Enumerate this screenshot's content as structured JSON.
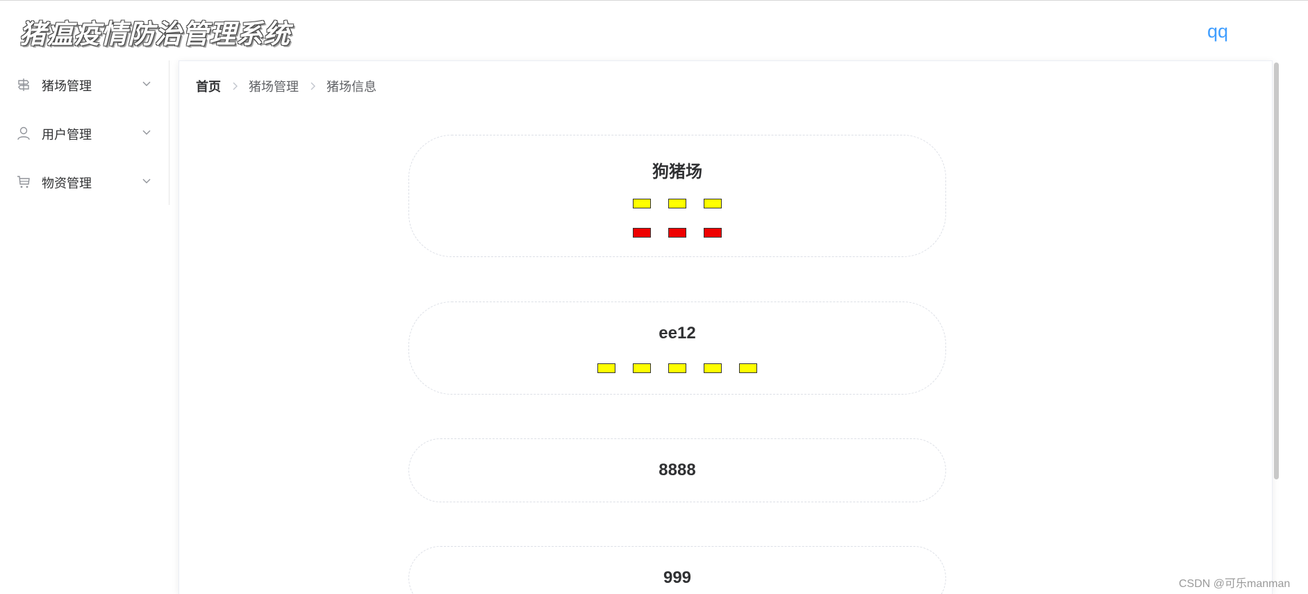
{
  "app": {
    "title": "猪瘟疫情防治管理系统",
    "user": "qq"
  },
  "sidebar": {
    "items": [
      {
        "label": "猪场管理",
        "icon": "signpost-icon"
      },
      {
        "label": "用户管理",
        "icon": "user-icon"
      },
      {
        "label": "物资管理",
        "icon": "cart-icon"
      }
    ]
  },
  "breadcrumb": {
    "items": [
      "首页",
      "猪场管理",
      "猪场信息"
    ]
  },
  "colors": {
    "accent": "#409eff",
    "pen_yellow": "#ffff00",
    "pen_red": "#ee0000"
  },
  "farms": [
    {
      "name": "狗猪场",
      "rows": [
        [
          "yellow",
          "yellow",
          "yellow"
        ],
        [
          "red",
          "red",
          "red"
        ]
      ]
    },
    {
      "name": "ee12",
      "rows": [
        [
          "yellow",
          "yellow",
          "yellow",
          "yellow",
          "yellow"
        ]
      ]
    },
    {
      "name": "8888",
      "rows": []
    },
    {
      "name": "999",
      "rows": []
    }
  ],
  "watermark": "CSDN @可乐manman"
}
